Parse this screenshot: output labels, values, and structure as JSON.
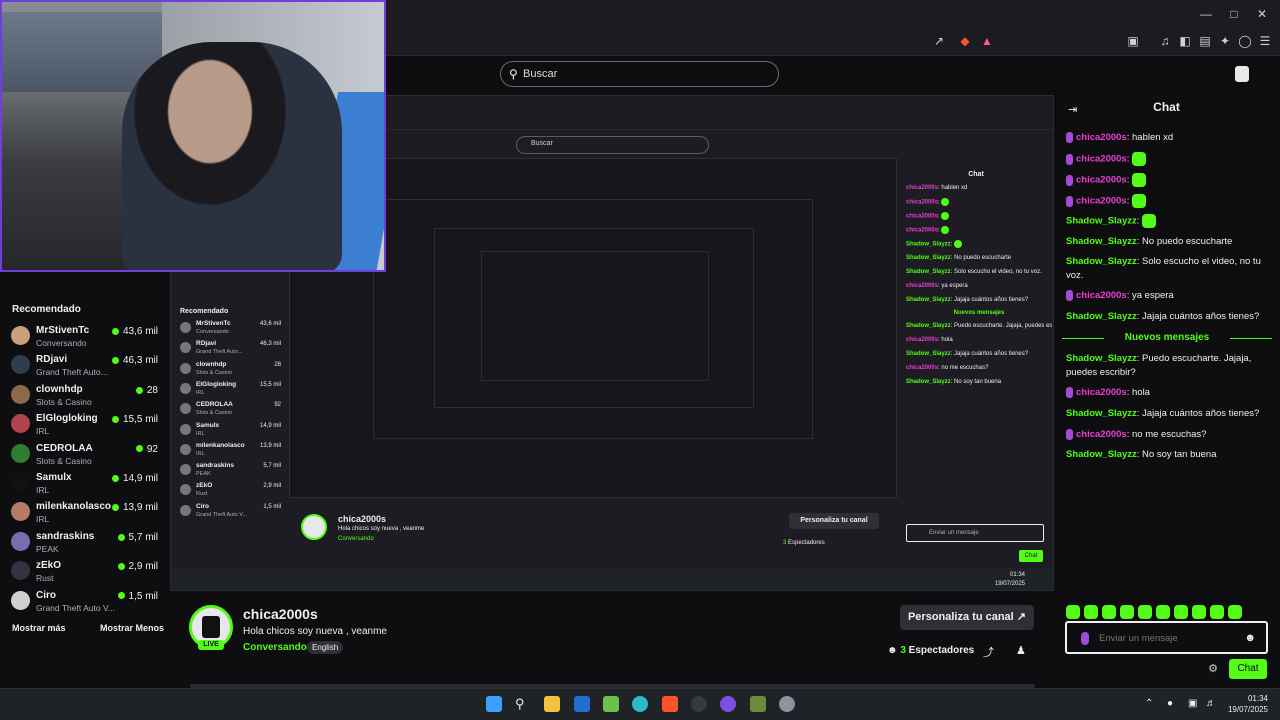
{
  "browser": {
    "search_placeholder": "Buscar",
    "window_controls": [
      "minimize-icon",
      "maximize-icon",
      "close-icon"
    ]
  },
  "sidebar": {
    "title": "Recomendado",
    "channels": [
      {
        "name": "MrStivenTc",
        "category": "Conversando",
        "viewers": "43,6 mil"
      },
      {
        "name": "RDjavi",
        "category": "Grand Theft Auto...",
        "viewers": "46,3 mil"
      },
      {
        "name": "clownhdp",
        "category": "Slots & Casino",
        "viewers": "28"
      },
      {
        "name": "ElGlogloking",
        "category": "IRL",
        "viewers": "15,5 mil"
      },
      {
        "name": "CEDROLAA",
        "category": "Slots & Casino",
        "viewers": "92"
      },
      {
        "name": "Samulx",
        "category": "IRL",
        "viewers": "14,9 mil"
      },
      {
        "name": "milenkanolasco",
        "category": "IRL",
        "viewers": "13,9 mil"
      },
      {
        "name": "sandraskins",
        "category": "PEAK",
        "viewers": "5,7 mil"
      },
      {
        "name": "zEkO",
        "category": "Rust",
        "viewers": "2,9 mil"
      },
      {
        "name": "Ciro",
        "category": "Grand Theft Auto V...",
        "viewers": "1,5 mil"
      }
    ],
    "show_more": "Mostrar más",
    "show_less": "Mostrar Menos"
  },
  "mirror_sidebar": {
    "channels": [
      {
        "name": "MrStivenTc",
        "category": "Conversando",
        "viewers": "43,6 mil"
      },
      {
        "name": "RDjavi",
        "category": "Grand Theft Auto...",
        "viewers": "46,3 mil"
      },
      {
        "name": "clownhdp",
        "category": "Slots & Casino",
        "viewers": "28"
      },
      {
        "name": "ElGlogloking",
        "category": "IRL",
        "viewers": "15,5 mil"
      },
      {
        "name": "CEDROLAA",
        "category": "Slots & Casino",
        "viewers": "92"
      },
      {
        "name": "Samulx",
        "category": "IRL",
        "viewers": "14,9 mil"
      },
      {
        "name": "milenkanolasco",
        "category": "IRL",
        "viewers": "13,9 mil"
      },
      {
        "name": "sandraskins",
        "category": "PEAK",
        "viewers": "5,7 mil"
      },
      {
        "name": "zEkO",
        "category": "Rust",
        "viewers": "2,9 mil"
      },
      {
        "name": "Ciro",
        "category": "Grand Theft Auto V...",
        "viewers": "1,5 mil"
      }
    ]
  },
  "chat": {
    "title": "Chat",
    "new_messages": "Nuevos mensajes",
    "messages": [
      {
        "user": "chica2000s",
        "text": "hablen xd"
      },
      {
        "user": "chica2000s",
        "text": ""
      },
      {
        "user": "chica2000s",
        "text": ""
      },
      {
        "user": "chica2000s",
        "text": ""
      },
      {
        "user": "Shadow_Slayzz",
        "text": ""
      },
      {
        "user": "Shadow_Slayzz",
        "text": "No puedo escucharte"
      },
      {
        "user": "Shadow_Slayzz",
        "text": "Solo escucho el video, no tu voz."
      },
      {
        "user": "chica2000s",
        "text": "ya espera"
      },
      {
        "user": "Shadow_Slayzz",
        "text": "Jajaja cuántos años tienes?"
      },
      {
        "user": "Shadow_Slayzz",
        "text": "Puedo escucharte. Jajaja, puedes escribir?"
      },
      {
        "user": "chica2000s",
        "text": "hola"
      },
      {
        "user": "Shadow_Slayzz",
        "text": "Jajaja cuántos años tienes?"
      },
      {
        "user": "chica2000s",
        "text": "no me escuchas?"
      },
      {
        "user": "Shadow_Slayzz",
        "text": "No soy tan buena"
      }
    ],
    "input_placeholder": "Enviar un mensaje",
    "send_label": "Chat"
  },
  "channel": {
    "name": "chica2000s",
    "title": "Hola chicos soy nueva , veanme",
    "status": "Conversando",
    "language": "English",
    "live_badge": "LIVE",
    "customize_label": "Personaliza tu canal",
    "viewers_count": "3",
    "viewers_label": "Espectadores"
  },
  "taskbar": {
    "time": "01:34",
    "date": "19/07/2025"
  },
  "colors": {
    "accent_green": "#53fc18",
    "chat_user_pink": "#e83fd1",
    "webcam_border": "#6f3fd9",
    "background": "#0e0e10"
  }
}
